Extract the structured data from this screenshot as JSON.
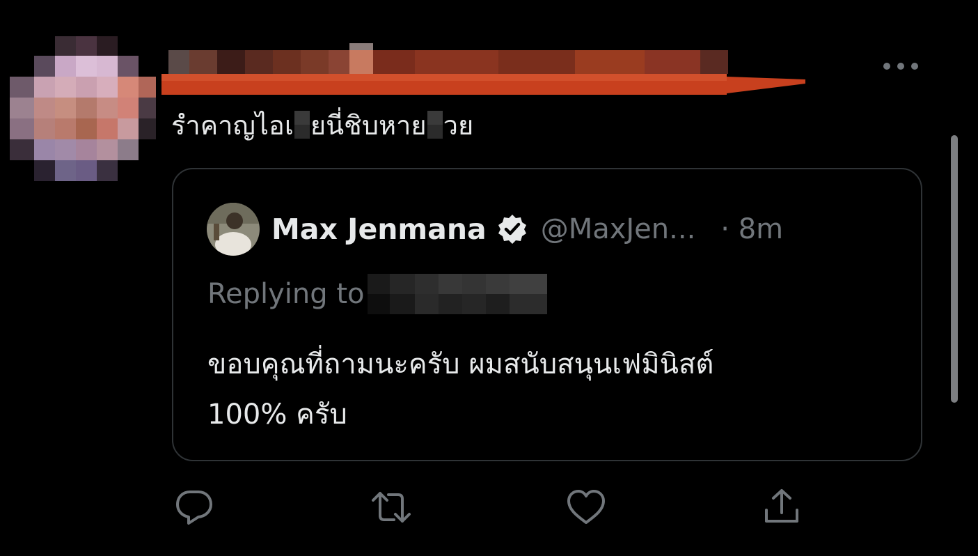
{
  "tweet": {
    "text_part1": "รำคาญไอเ",
    "text_part2": "ยนี่ชิบหาย ",
    "text_part3": "วย"
  },
  "quoted_tweet": {
    "name": "Max Jenmana",
    "handle": "@MaxJen...",
    "time": "· 8m",
    "replying_label": "Replying to",
    "body_line1": "ขอบคุณที่ถามนะครับ ผมสนับสนุนเฟมินิสต์",
    "body_line2": "100% ครับ"
  },
  "icons": {
    "more": "more-icon",
    "verified": "verified-badge-icon",
    "reply": "reply-icon",
    "retweet": "retweet-icon",
    "like": "like-icon",
    "share": "share-icon"
  },
  "colors": {
    "background": "#000000",
    "text": "#e7e9ea",
    "secondary": "#71767b",
    "border": "#2f3336",
    "name_bar_highlight": "#c63c1c"
  }
}
